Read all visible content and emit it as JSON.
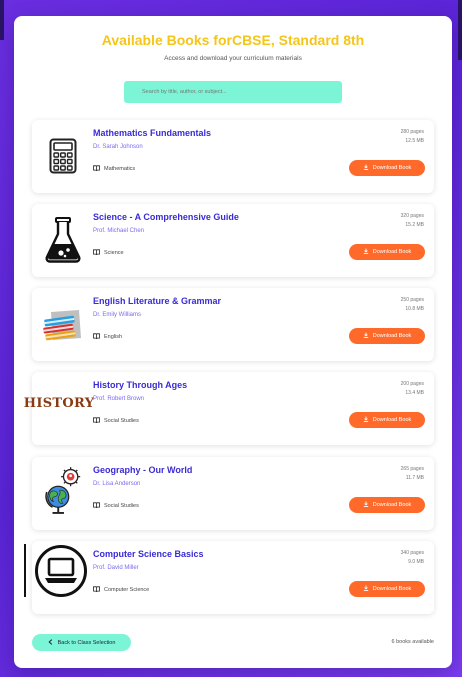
{
  "header": {
    "title": "Available Books forCBSE, Standard 8th",
    "subtitle": "Access and download your curriculum materials"
  },
  "search": {
    "placeholder": "Search by title, author, or subject..."
  },
  "books": [
    {
      "title": "Mathematics Fundamentals",
      "author": "Dr. Sarah Johnson",
      "subject": "Mathematics",
      "pages": "280 pages",
      "size": "12.5 MB",
      "download_label": "Download Book",
      "icon": "calculator-icon"
    },
    {
      "title": "Science - A Comprehensive Guide",
      "author": "Prof. Michael Chen",
      "subject": "Science",
      "pages": "320 pages",
      "size": "15.2 MB",
      "download_label": "Download Book",
      "icon": "flask-icon"
    },
    {
      "title": "English Literature & Grammar",
      "author": "Dr. Emily Williams",
      "subject": "English",
      "pages": "250 pages",
      "size": "10.8 MB",
      "download_label": "Download Book",
      "icon": "books-stack-icon"
    },
    {
      "title": "History Through Ages",
      "author": "Prof. Robert Brown",
      "subject": "Social Studies",
      "pages": "200 pages",
      "size": "13.4 MB",
      "download_label": "Download Book",
      "icon": "history-text-icon",
      "cover_text": "HISTORY"
    },
    {
      "title": "Geography - Our World",
      "author": "Dr. Lisa Anderson",
      "subject": "Social Studies",
      "pages": "265 pages",
      "size": "11.7 MB",
      "download_label": "Download Book",
      "icon": "globe-icon"
    },
    {
      "title": "Computer Science Basics",
      "author": "Prof. David Miller",
      "subject": "Computer Science",
      "pages": "340 pages",
      "size": "9.0 MB",
      "download_label": "Download Book",
      "icon": "laptop-icon"
    }
  ],
  "footer": {
    "back_label": "Back to Class Selection",
    "count_label": "6 books available"
  },
  "colors": {
    "title": "#f5c518",
    "accent": "#3a2bd6",
    "download": "#ff6a2b",
    "mint": "#7cf5d6"
  }
}
